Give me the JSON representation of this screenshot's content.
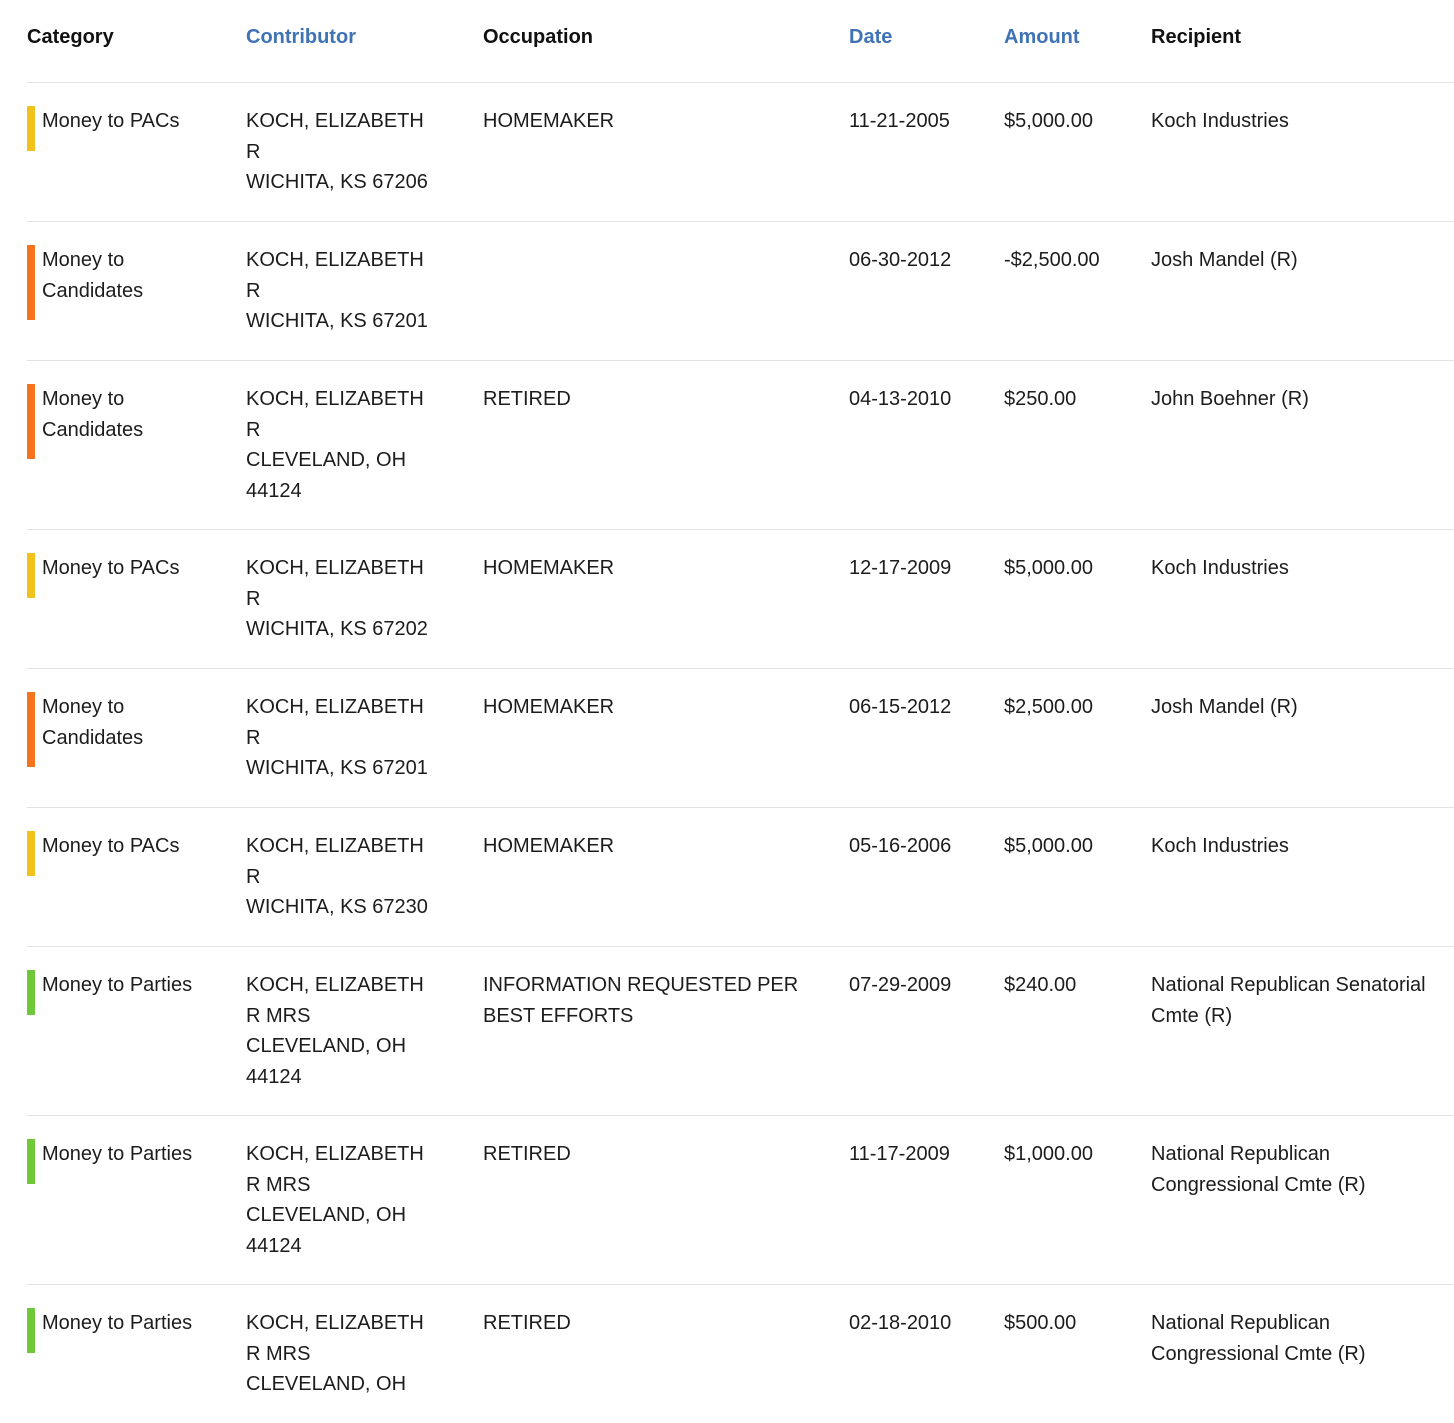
{
  "headers": {
    "category": "Category",
    "contributor": "Contributor",
    "occupation": "Occupation",
    "date": "Date",
    "amount": "Amount",
    "recipient": "Recipient"
  },
  "colors": {
    "sortable_header": "#3f73b5",
    "money_to_pacs": "#f1c21b",
    "money_to_candidates": "#f5731d",
    "money_to_parties": "#6fc83a"
  },
  "rows": [
    {
      "category": [
        "Money to PACs"
      ],
      "category_color": "#f1c21b",
      "contributor": [
        "KOCH, ELIZABETH",
        "R",
        "WICHITA, KS 67206"
      ],
      "occupation": [
        "HOMEMAKER"
      ],
      "date": "11-21-2005",
      "amount": "$5,000.00",
      "recipient": [
        "Koch Industries"
      ]
    },
    {
      "category": [
        "Money to",
        "Candidates"
      ],
      "category_color": "#f5731d",
      "contributor": [
        "KOCH, ELIZABETH",
        "R",
        "WICHITA, KS 67201"
      ],
      "occupation": [],
      "date": "06-30-2012",
      "amount": "-$2,500.00",
      "recipient": [
        "Josh Mandel (R)"
      ]
    },
    {
      "category": [
        "Money to",
        "Candidates"
      ],
      "category_color": "#f5731d",
      "contributor": [
        "KOCH, ELIZABETH",
        "R",
        "CLEVELAND, OH",
        "44124"
      ],
      "occupation": [
        "RETIRED"
      ],
      "date": "04-13-2010",
      "amount": "$250.00",
      "recipient": [
        "John Boehner (R)"
      ]
    },
    {
      "category": [
        "Money to PACs"
      ],
      "category_color": "#f1c21b",
      "contributor": [
        "KOCH, ELIZABETH",
        "R",
        "WICHITA, KS 67202"
      ],
      "occupation": [
        "HOMEMAKER"
      ],
      "date": "12-17-2009",
      "amount": "$5,000.00",
      "recipient": [
        "Koch Industries"
      ]
    },
    {
      "category": [
        "Money to",
        "Candidates"
      ],
      "category_color": "#f5731d",
      "contributor": [
        "KOCH, ELIZABETH",
        "R",
        "WICHITA, KS 67201"
      ],
      "occupation": [
        "HOMEMAKER"
      ],
      "date": "06-15-2012",
      "amount": "$2,500.00",
      "recipient": [
        "Josh Mandel (R)"
      ]
    },
    {
      "category": [
        "Money to PACs"
      ],
      "category_color": "#f1c21b",
      "contributor": [
        "KOCH, ELIZABETH",
        "R",
        "WICHITA, KS 67230"
      ],
      "occupation": [
        "HOMEMAKER"
      ],
      "date": "05-16-2006",
      "amount": "$5,000.00",
      "recipient": [
        "Koch Industries"
      ]
    },
    {
      "category": [
        "Money to Parties"
      ],
      "category_color": "#6fc83a",
      "contributor": [
        "KOCH, ELIZABETH",
        "R MRS",
        "CLEVELAND, OH",
        "44124"
      ],
      "occupation": [
        "INFORMATION REQUESTED PER",
        "BEST EFFORTS"
      ],
      "date": "07-29-2009",
      "amount": "$240.00",
      "recipient": [
        "National Republican Senatorial",
        "Cmte (R)"
      ]
    },
    {
      "category": [
        "Money to Parties"
      ],
      "category_color": "#6fc83a",
      "contributor": [
        "KOCH, ELIZABETH",
        "R MRS",
        "CLEVELAND, OH",
        "44124"
      ],
      "occupation": [
        "RETIRED"
      ],
      "date": "11-17-2009",
      "amount": "$1,000.00",
      "recipient": [
        "National Republican",
        "Congressional Cmte (R)"
      ]
    },
    {
      "category": [
        "Money to Parties"
      ],
      "category_color": "#6fc83a",
      "contributor": [
        "KOCH, ELIZABETH",
        "R MRS",
        "CLEVELAND, OH"
      ],
      "occupation": [
        "RETIRED"
      ],
      "date": "02-18-2010",
      "amount": "$500.00",
      "recipient": [
        "National Republican",
        "Congressional Cmte (R)"
      ]
    }
  ]
}
